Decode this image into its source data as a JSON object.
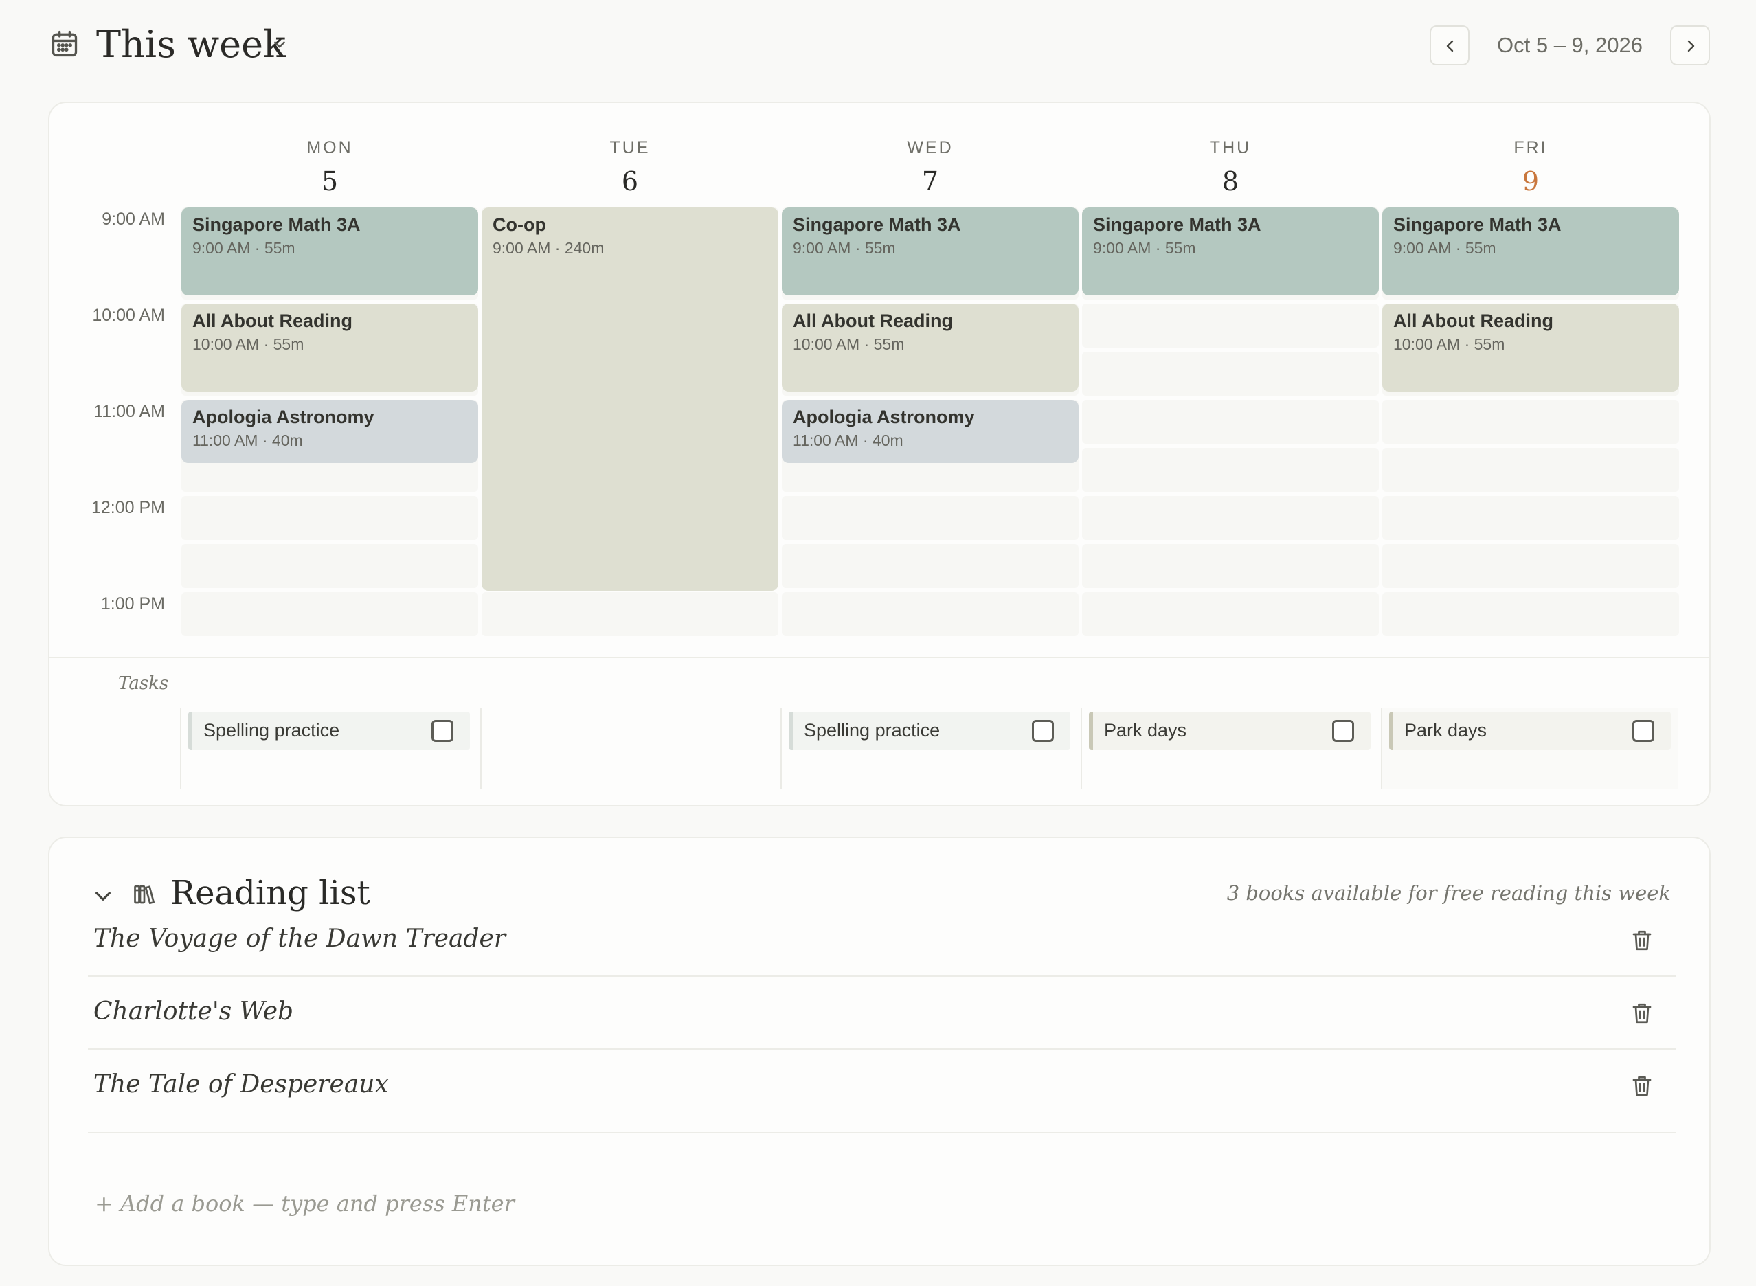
{
  "header": {
    "title": "This week",
    "date_range": "Oct 5 – 9, 2026"
  },
  "week": {
    "days": [
      {
        "name": "MON",
        "num": "5"
      },
      {
        "name": "TUE",
        "num": "6"
      },
      {
        "name": "WED",
        "num": "7"
      },
      {
        "name": "THU",
        "num": "8"
      },
      {
        "name": "FRI",
        "num": "9"
      }
    ],
    "times": [
      "9:00 AM",
      "10:00 AM",
      "11:00 AM",
      "12:00 PM",
      "1:00 PM"
    ],
    "events": {
      "mon_math": {
        "title": "Singapore Math 3A",
        "sub": "9:00 AM · 55m"
      },
      "mon_read": {
        "title": "All About Reading",
        "sub": "10:00 AM · 55m"
      },
      "mon_astro": {
        "title": "Apologia Astronomy",
        "sub": "11:00 AM · 40m"
      },
      "tue_coop": {
        "title": "Co-op",
        "sub": "9:00 AM · 240m"
      },
      "wed_math": {
        "title": "Singapore Math 3A",
        "sub": "9:00 AM · 55m"
      },
      "wed_read": {
        "title": "All About Reading",
        "sub": "10:00 AM · 55m"
      },
      "wed_astro": {
        "title": "Apologia Astronomy",
        "sub": "11:00 AM · 40m"
      },
      "thu_math": {
        "title": "Singapore Math 3A",
        "sub": "9:00 AM · 55m"
      },
      "fri_math": {
        "title": "Singapore Math 3A",
        "sub": "9:00 AM · 55m"
      },
      "fri_read": {
        "title": "All About Reading",
        "sub": "10:00 AM · 55m"
      }
    },
    "tasks_label": "Tasks",
    "tasks": {
      "mon": "Spelling practice",
      "wed": "Spelling practice",
      "thu": "Park days",
      "fri": "Park days"
    }
  },
  "reading": {
    "title": "Reading list",
    "note": "3 books available for free reading this week",
    "books": [
      "The Voyage of the Dawn Treader",
      "Charlotte's Web",
      "The Tale of Despereaux"
    ],
    "add_placeholder": "+ Add a book — type and press Enter"
  }
}
